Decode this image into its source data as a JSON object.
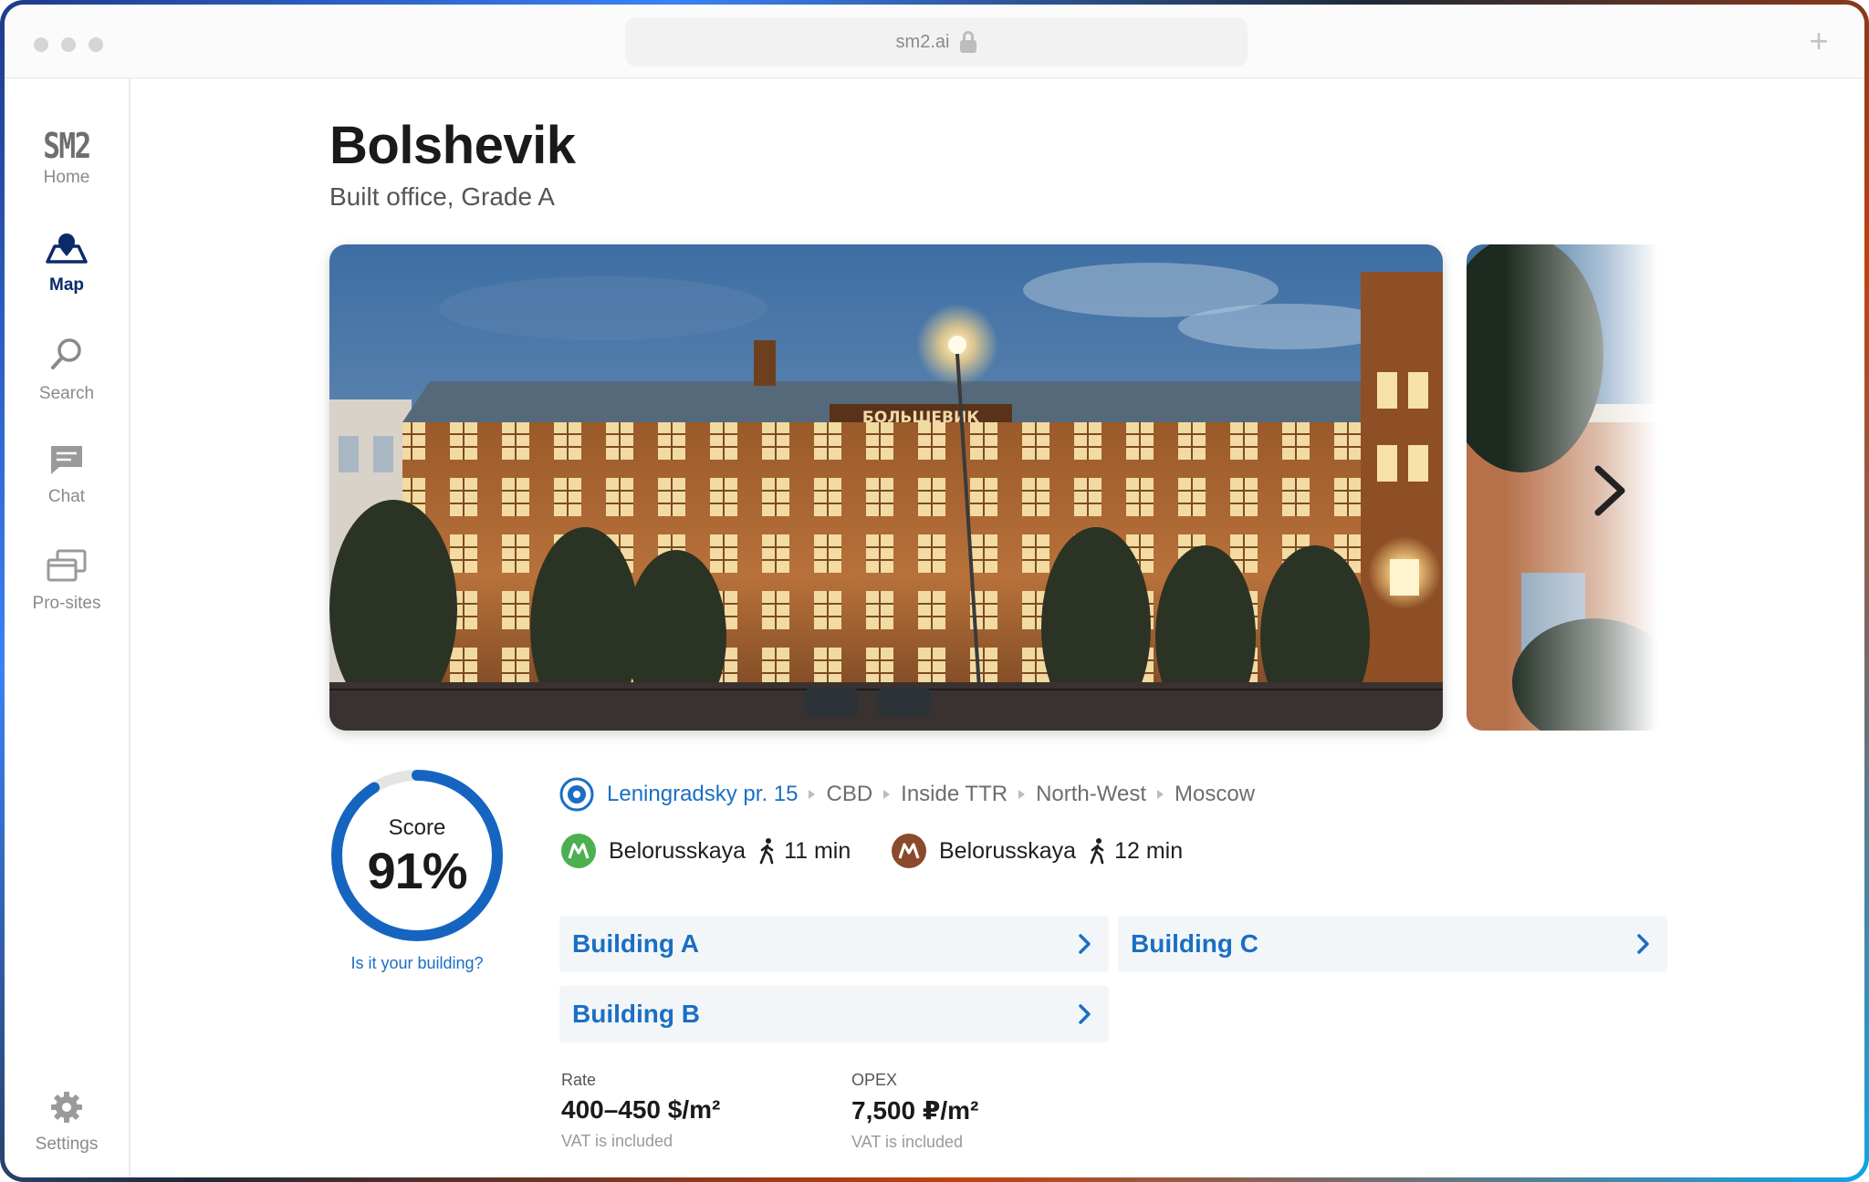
{
  "browser": {
    "url": "sm2.ai"
  },
  "sidebar": {
    "logo": "SM2",
    "items": [
      {
        "label": "Home",
        "icon": "sm2-logo-icon"
      },
      {
        "label": "Map",
        "icon": "map-pin-icon",
        "active": true
      },
      {
        "label": "Search",
        "icon": "search-icon"
      },
      {
        "label": "Chat",
        "icon": "chat-icon"
      },
      {
        "label": "Pro-sites",
        "icon": "pro-sites-icon"
      }
    ],
    "settings": {
      "label": "Settings",
      "icon": "gear-icon"
    }
  },
  "property": {
    "name": "Bolshevik",
    "subtitle": "Built office, Grade A",
    "facade_sign": "БОЛЬШЕВИК",
    "score": {
      "label": "Score",
      "value": "91%",
      "percent": 91,
      "claim_link": "Is it your building?"
    },
    "address": {
      "street": "Leningradsky pr. 15",
      "path": [
        "CBD",
        "Inside TTR",
        "North-West",
        "Moscow"
      ]
    },
    "metro": [
      {
        "station": "Belorusskaya",
        "time": "11 min",
        "color": "#4caf50"
      },
      {
        "station": "Belorusskaya",
        "time": "12 min",
        "color": "#8b4a2b"
      }
    ],
    "buildings": [
      "Building A",
      "Building C",
      "Building B"
    ],
    "rate": {
      "label": "Rate",
      "value": "400–450 $/m²",
      "note": "VAT is included"
    },
    "opex": {
      "label": "OPEX",
      "value": "7,500 ₽/m²",
      "note": "VAT is included"
    }
  },
  "colors": {
    "accent": "#1a6fc4",
    "nav_active": "#0a2a6b",
    "score_ring": "#1565c0"
  }
}
